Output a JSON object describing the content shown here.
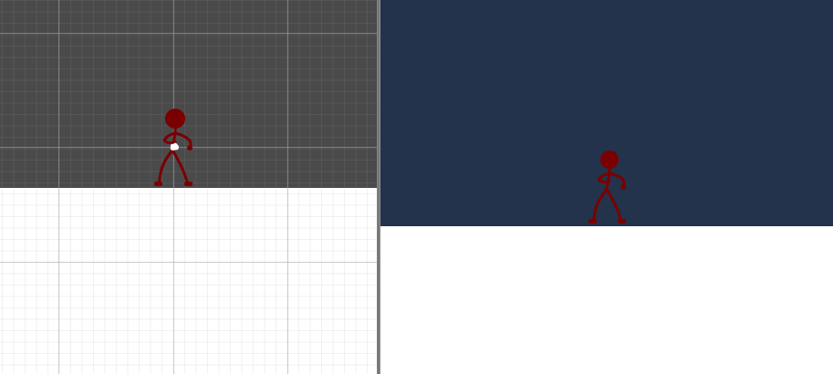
{
  "scene_view": {
    "background": "#4a4a4a",
    "ground": "#ffffff",
    "character": {
      "name": "stick-figure",
      "color": "#7a0000",
      "icon": "stickman-icon"
    },
    "gizmo": {
      "icon": "hand-move-icon",
      "color": "#ffffff"
    }
  },
  "game_view": {
    "camera_background": "#22334b",
    "character": {
      "name": "stick-figure",
      "color": "#7a0000",
      "icon": "stickman-icon"
    }
  }
}
